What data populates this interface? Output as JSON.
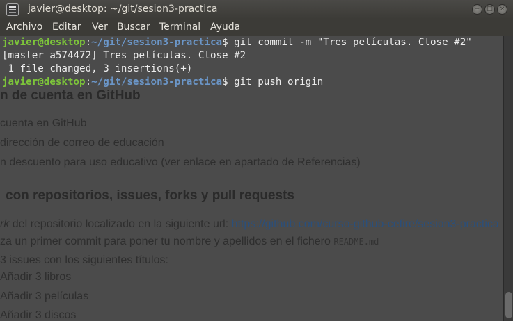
{
  "window": {
    "title": "javier@desktop: ~/git/sesion3-practica",
    "buttons": [
      "−",
      "□",
      "×"
    ]
  },
  "menu": [
    "Archivo",
    "Editar",
    "Ver",
    "Buscar",
    "Terminal",
    "Ayuda"
  ],
  "terminal": {
    "line1": {
      "user": "javier@desktop",
      "sep": ":",
      "path": "~/git/sesion3-practica",
      "cmd": "$ git commit -m \"Tres películas. Close #2\""
    },
    "line2": "[master a574472] Tres películas. Close #2",
    "line3": " 1 file changed, 3 insertions(+)",
    "line4": {
      "user": "javier@desktop",
      "sep": ":",
      "path": "~/git/sesion3-practica",
      "cmd": "$ git push origin"
    }
  },
  "background_page": {
    "heading1": "n de cuenta en GitHub",
    "item1": "cuenta en GitHub",
    "item2": "dirección de correo de educación",
    "item3": "n descuento para uso educativo (ver enlace en apartado de Referencias)",
    "heading2": "con repositorios, issues, forks y pull requests",
    "item4_em": "rk",
    "item4_text": " del repositorio localizado en la siguiente url: ",
    "item4_link": "https://github.com/curso-github-cefire/sesion3-practica",
    "item5_text": "za un primer commit para poner tu nombre y apellidos en el fichero ",
    "item5_code": "README.md",
    "item6": "3 issues con los siguientes títulos:",
    "item7": "Añadir 3 libros",
    "item8": "Añadir 3 películas",
    "item9": "Añadir 3 discos"
  }
}
